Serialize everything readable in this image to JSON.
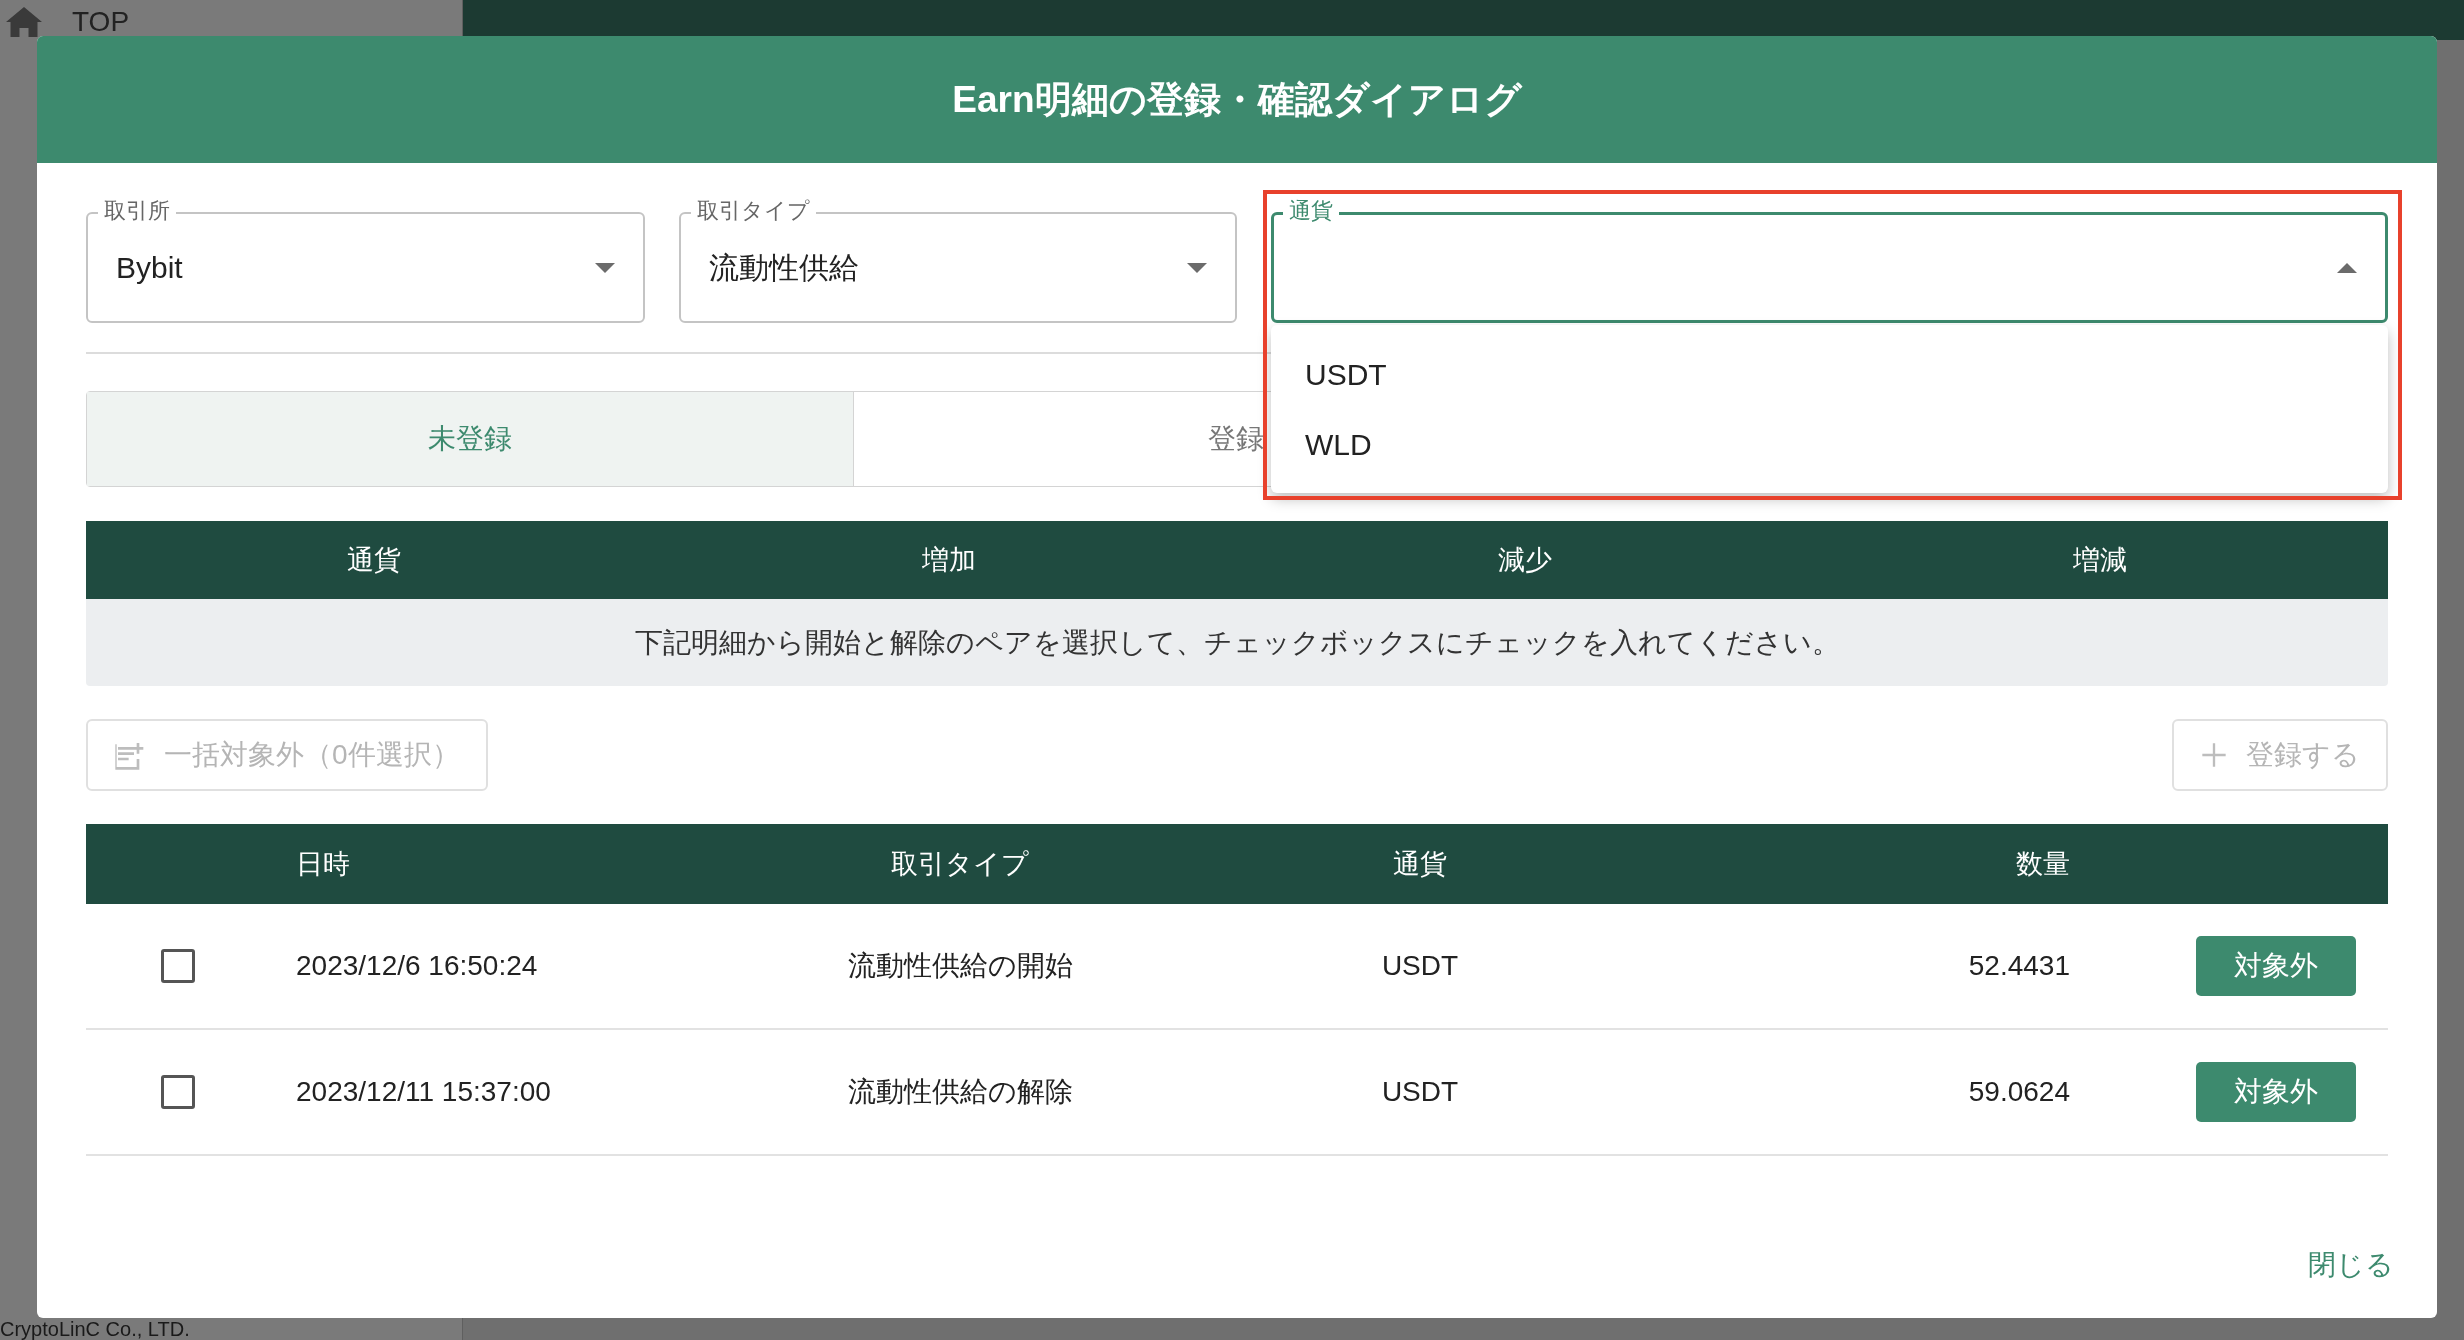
{
  "background": {
    "sidebar_items": [
      {
        "label": "TOP"
      }
    ],
    "footer": "CryptoLinC Co., LTD."
  },
  "dialog": {
    "title": "Earn明細の登録・確認ダイアログ",
    "fields": [
      {
        "label": "取引所",
        "value": "Bybit",
        "open": false,
        "highlighted": false
      },
      {
        "label": "取引タイプ",
        "value": "流動性供給",
        "open": false,
        "highlighted": false
      },
      {
        "label": "通貨",
        "open": true,
        "highlighted": true,
        "options": [
          "USDT",
          "WLD"
        ]
      }
    ],
    "tabs": [
      {
        "label": "未登録",
        "selected": true
      },
      {
        "label": "登録",
        "selected": false
      }
    ],
    "summary_table": {
      "columns": [
        "通貨",
        "増加",
        "減少",
        "増減"
      ],
      "notice": "下記明細から開始と解除のペアを選択して、チェックボックスにチェックを入れてください。"
    },
    "actions": [
      {
        "kind": "exclude",
        "label": "一括対象外（0件選択）",
        "disabled": true
      },
      {
        "kind": "register",
        "label": "登録する",
        "disabled": true
      }
    ],
    "detail_table": {
      "columns": [
        "日時",
        "取引タイプ",
        "通貨",
        "数量"
      ],
      "rows": [
        {
          "checked": false,
          "datetime": "2023/12/6 16:50:24",
          "type": "流動性供給の開始",
          "currency": "USDT",
          "amount": "52.4431",
          "action": "対象外"
        },
        {
          "checked": false,
          "datetime": "2023/12/11 15:37:00",
          "type": "流動性供給の解除",
          "currency": "USDT",
          "amount": "59.0624",
          "action": "対象外"
        }
      ]
    },
    "close": "閉じる"
  }
}
